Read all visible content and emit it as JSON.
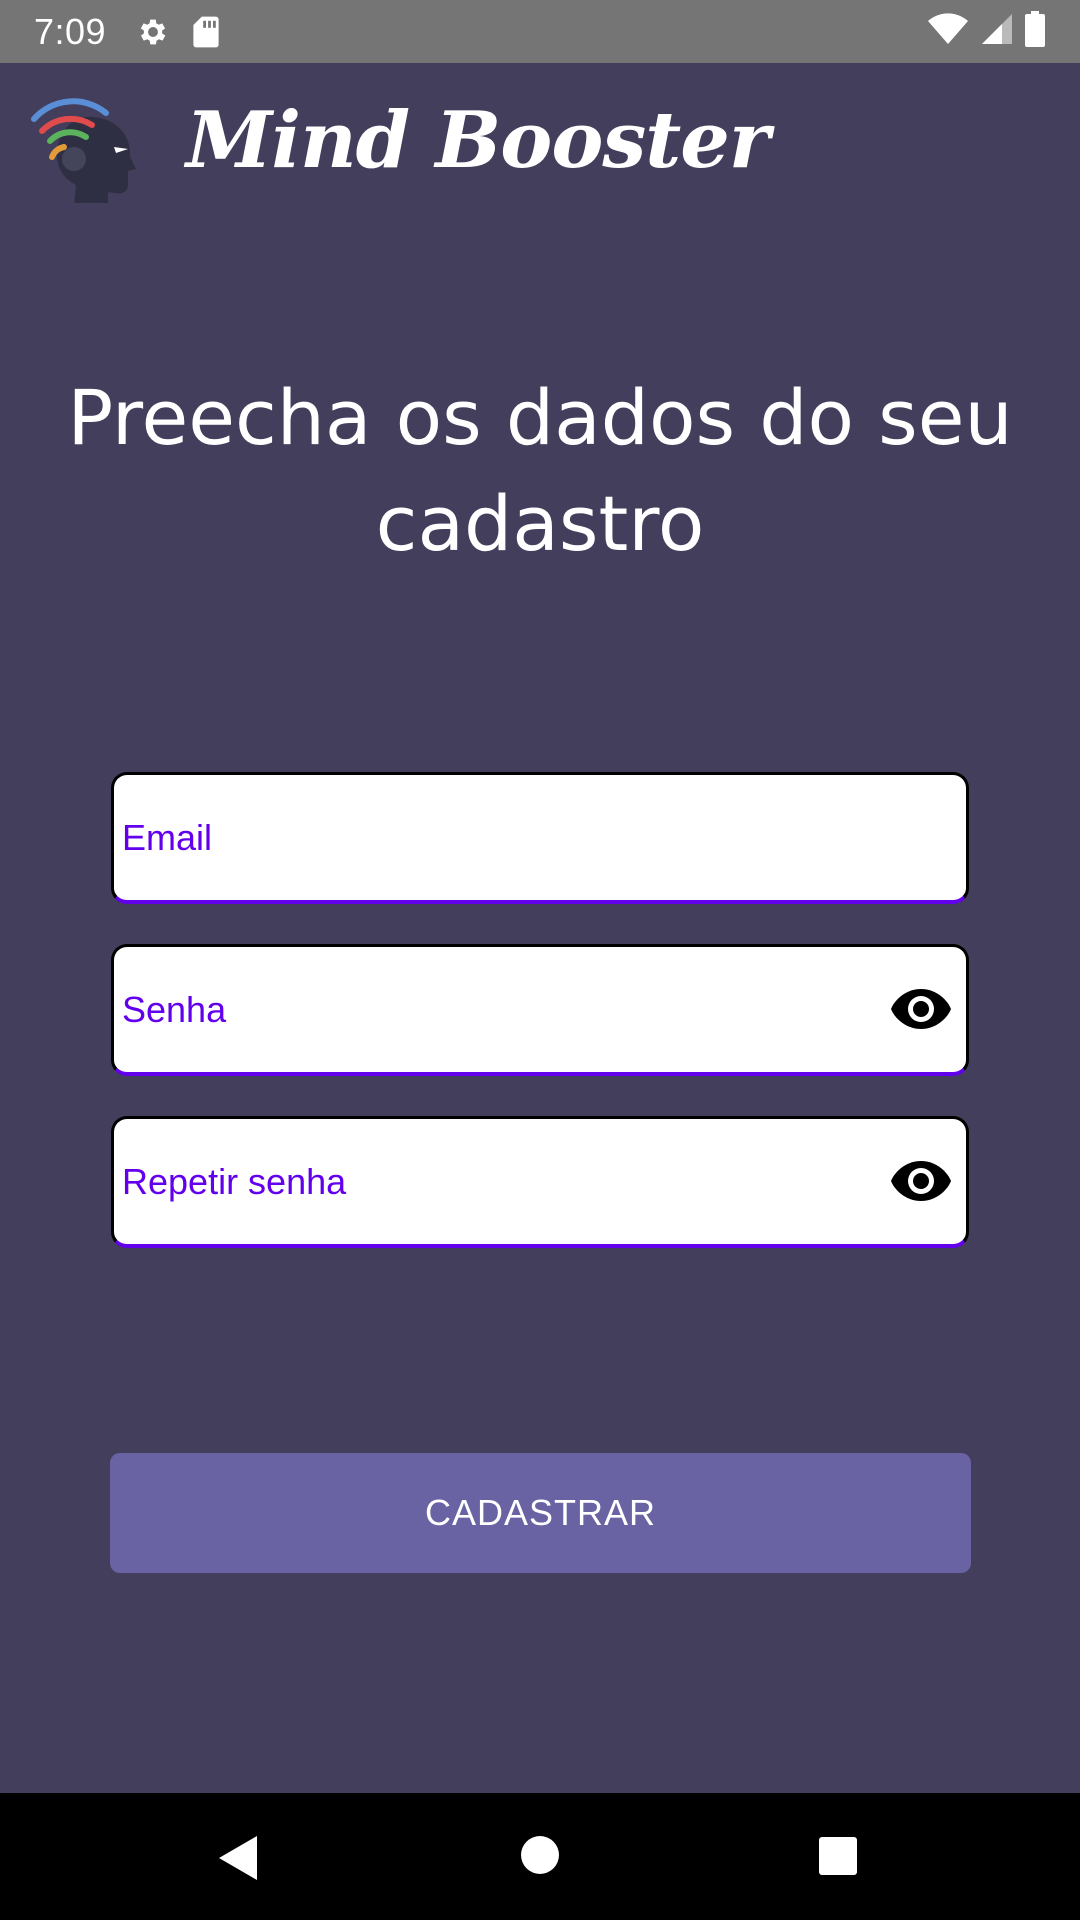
{
  "status_bar": {
    "time": "7:09",
    "left_icons": [
      "gear-icon",
      "sd-card-icon"
    ],
    "right_icons": [
      "wifi-icon",
      "cell-signal-icon",
      "battery-icon"
    ]
  },
  "header": {
    "app_title": "Mind Booster",
    "logo_icon": "mind-booster-logo-icon"
  },
  "form": {
    "heading": "Preecha os dados do seu cadastro",
    "email": {
      "placeholder": "Email",
      "value": ""
    },
    "senha": {
      "placeholder": "Senha",
      "value": "",
      "toggle_icon": "eye-icon"
    },
    "repetir_senha": {
      "placeholder": "Repetir senha",
      "value": "",
      "toggle_icon": "eye-icon"
    },
    "submit_label": "CADASTRAR"
  },
  "nav_bar": {
    "icons": [
      "back-triangle-icon",
      "home-circle-icon",
      "recents-square-icon"
    ]
  },
  "colors": {
    "background": "#423e5c",
    "status_bar": "#757575",
    "accent": "#6200ee",
    "button": "#6a63a3",
    "nav_bar": "#000000"
  }
}
